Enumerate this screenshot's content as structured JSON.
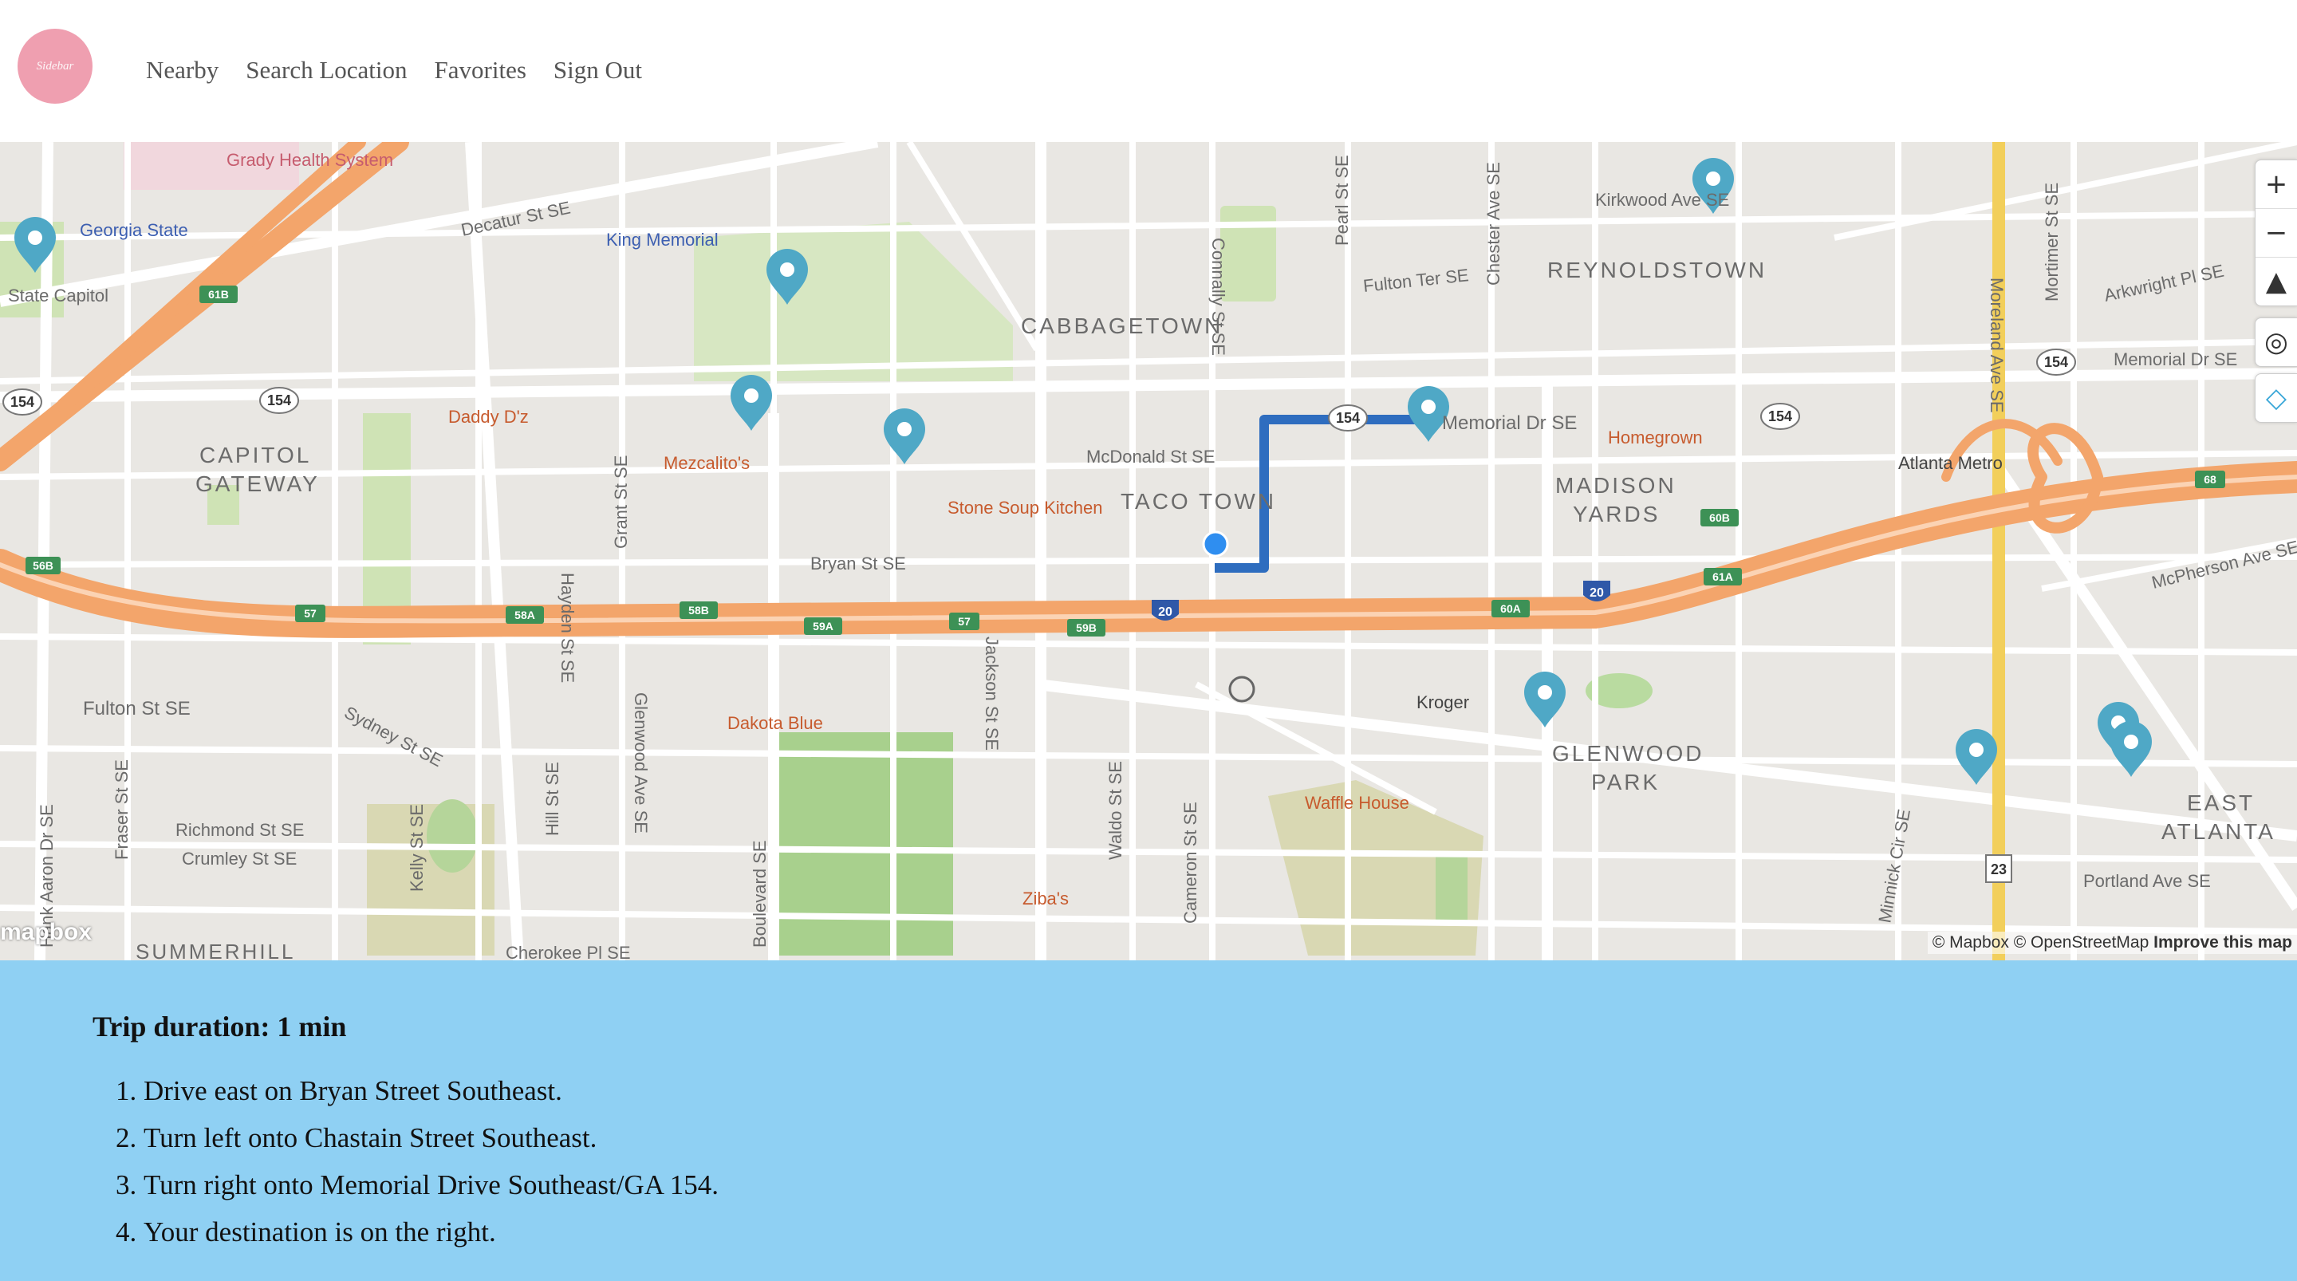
{
  "logo": {
    "text": "Sidebar"
  },
  "nav": {
    "nearby": "Nearby",
    "search": "Search Location",
    "favorites": "Favorites",
    "signout": "Sign Out"
  },
  "map": {
    "labels": {
      "grady": "Grady Health System",
      "georgia_state": "Georgia State",
      "decatur": "Decatur St SE",
      "king_memorial": "King Memorial",
      "state_capitol": "State Capitol",
      "cabbagetown": "CABBAGETOWN",
      "reynoldstown": "REYNOLDSTOWN",
      "kirkwood": "Kirkwood Ave SE",
      "fulton_ter": "Fulton Ter SE",
      "arkwright": "Arkwright Pl SE",
      "memorial_right": "Memorial Dr SE",
      "memorial_mid": "Memorial Dr SE",
      "capitol_gateway": [
        "CAPITOL",
        "GATEWAY"
      ],
      "daddy_dz": "Daddy D'z",
      "mezcalitos": "Mezcalito's",
      "stone_soup": "Stone Soup Kitchen",
      "mcdonald": "McDonald St SE",
      "taco_town": "TACO TOWN",
      "homegrown": "Homegrown",
      "madison_yards": [
        "MADISON",
        "YARDS"
      ],
      "atlanta_metro": "Atlanta Metro",
      "mcpherson": "McPherson Ave SE",
      "bryan": "Bryan St SE",
      "fulton_st": "Fulton St SE",
      "sydney": "Sydney St SE",
      "dakota_blue": "Dakota Blue",
      "kroger": "Kroger",
      "glenwood_park": [
        "GLENWOOD",
        "PARK"
      ],
      "east_atlanta": [
        "EAST",
        "ATLANTA"
      ],
      "waffle_house": "Waffle House",
      "richmond": "Richmond St SE",
      "crumley": "Crumley St SE",
      "summerhill": "SUMMERHILL",
      "zibas": "Ziba's",
      "portland": "Portland Ave SE",
      "cherokee": "Cherokee Pl SE",
      "pearl": "Pearl St SE",
      "chester": "Chester Ave SE",
      "moreland": "Moreland Ave SE",
      "mortimer": "Mortimer St SE",
      "grant": "Grant St SE",
      "hill": "Hill St SE",
      "boulevard": "Boulevard SE",
      "waldo": "Waldo St SE",
      "cameron": "Cameron St SE",
      "hank_aaron": "Hank Aaron Dr SE",
      "fraser": "Fraser St SE",
      "kelly": "Kelly St SE",
      "hayden": "Hayden St SE",
      "connally": "Connally St SE",
      "glenwood_ave": "Glenwood Ave SE",
      "jackson": "Jackson St SE",
      "minnick": "Minnick Cir SE",
      "shields": [
        "154",
        "154",
        "154",
        "154",
        "154",
        "23"
      ],
      "exits": [
        "56B",
        "57",
        "58A",
        "58B",
        "59A",
        "59B",
        "60A",
        "60B",
        "61A",
        "61B",
        "68",
        "57"
      ],
      "interstate": [
        "20",
        "20"
      ]
    },
    "controls": {
      "zoom_in": "+",
      "zoom_out": "−",
      "compass": "▲",
      "geolocate": "◎",
      "draw": "◇"
    },
    "attribution": {
      "mapbox": "© Mapbox",
      "osm": "© OpenStreetMap",
      "improve": "Improve this map"
    },
    "mapbox_logo": "mapbox",
    "route_color": "#2e6dbf",
    "pin_color": "#4fa8c6",
    "highway_color": "#f3a56b"
  },
  "directions": {
    "title": "Trip duration: 1 min",
    "steps": [
      "Drive east on Bryan Street Southeast.",
      "Turn left onto Chastain Street Southeast.",
      "Turn right onto Memorial Drive Southeast/GA 154.",
      "Your destination is on the right."
    ]
  }
}
